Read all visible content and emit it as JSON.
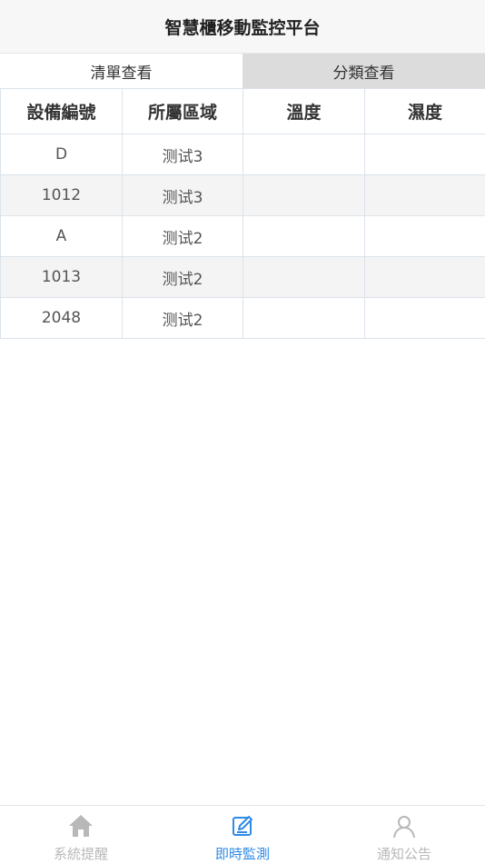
{
  "header": {
    "title": "智慧櫃移動監控平台"
  },
  "tabs": [
    {
      "label": "清單查看",
      "active": true
    },
    {
      "label": "分類查看",
      "active": false
    }
  ],
  "table": {
    "columns": [
      "設備編號",
      "所屬區域",
      "溫度",
      "濕度"
    ],
    "rows": [
      [
        "D",
        "测试3",
        "",
        ""
      ],
      [
        "1012",
        "测试3",
        "",
        ""
      ],
      [
        "A",
        "测试2",
        "",
        ""
      ],
      [
        "1013",
        "测试2",
        "",
        ""
      ],
      [
        "2048",
        "测试2",
        "",
        ""
      ]
    ]
  },
  "bottom_nav": [
    {
      "label": "系統提醒",
      "icon": "home-icon",
      "active": false
    },
    {
      "label": "即時監測",
      "icon": "edit-icon",
      "active": true
    },
    {
      "label": "通知公告",
      "icon": "user-icon",
      "active": false
    }
  ],
  "colors": {
    "accent": "#2f8be6",
    "inactive": "#b8b8b8",
    "tab_inactive_bg": "#dcdcdc"
  }
}
